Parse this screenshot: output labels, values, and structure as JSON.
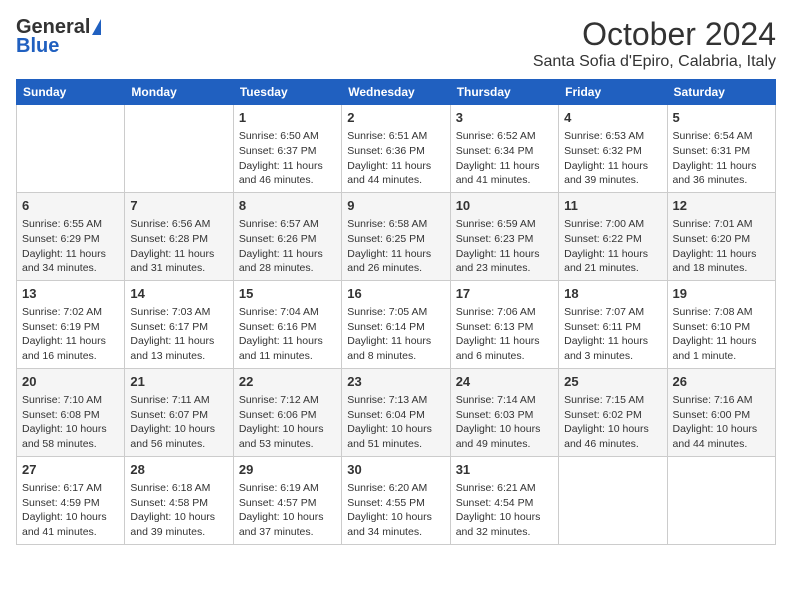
{
  "header": {
    "logo_general": "General",
    "logo_blue": "Blue",
    "month": "October 2024",
    "location": "Santa Sofia d'Epiro, Calabria, Italy"
  },
  "days_of_week": [
    "Sunday",
    "Monday",
    "Tuesday",
    "Wednesday",
    "Thursday",
    "Friday",
    "Saturday"
  ],
  "weeks": [
    [
      {
        "day": "",
        "info": ""
      },
      {
        "day": "",
        "info": ""
      },
      {
        "day": "1",
        "info": "Sunrise: 6:50 AM\nSunset: 6:37 PM\nDaylight: 11 hours and 46 minutes."
      },
      {
        "day": "2",
        "info": "Sunrise: 6:51 AM\nSunset: 6:36 PM\nDaylight: 11 hours and 44 minutes."
      },
      {
        "day": "3",
        "info": "Sunrise: 6:52 AM\nSunset: 6:34 PM\nDaylight: 11 hours and 41 minutes."
      },
      {
        "day": "4",
        "info": "Sunrise: 6:53 AM\nSunset: 6:32 PM\nDaylight: 11 hours and 39 minutes."
      },
      {
        "day": "5",
        "info": "Sunrise: 6:54 AM\nSunset: 6:31 PM\nDaylight: 11 hours and 36 minutes."
      }
    ],
    [
      {
        "day": "6",
        "info": "Sunrise: 6:55 AM\nSunset: 6:29 PM\nDaylight: 11 hours and 34 minutes."
      },
      {
        "day": "7",
        "info": "Sunrise: 6:56 AM\nSunset: 6:28 PM\nDaylight: 11 hours and 31 minutes."
      },
      {
        "day": "8",
        "info": "Sunrise: 6:57 AM\nSunset: 6:26 PM\nDaylight: 11 hours and 28 minutes."
      },
      {
        "day": "9",
        "info": "Sunrise: 6:58 AM\nSunset: 6:25 PM\nDaylight: 11 hours and 26 minutes."
      },
      {
        "day": "10",
        "info": "Sunrise: 6:59 AM\nSunset: 6:23 PM\nDaylight: 11 hours and 23 minutes."
      },
      {
        "day": "11",
        "info": "Sunrise: 7:00 AM\nSunset: 6:22 PM\nDaylight: 11 hours and 21 minutes."
      },
      {
        "day": "12",
        "info": "Sunrise: 7:01 AM\nSunset: 6:20 PM\nDaylight: 11 hours and 18 minutes."
      }
    ],
    [
      {
        "day": "13",
        "info": "Sunrise: 7:02 AM\nSunset: 6:19 PM\nDaylight: 11 hours and 16 minutes."
      },
      {
        "day": "14",
        "info": "Sunrise: 7:03 AM\nSunset: 6:17 PM\nDaylight: 11 hours and 13 minutes."
      },
      {
        "day": "15",
        "info": "Sunrise: 7:04 AM\nSunset: 6:16 PM\nDaylight: 11 hours and 11 minutes."
      },
      {
        "day": "16",
        "info": "Sunrise: 7:05 AM\nSunset: 6:14 PM\nDaylight: 11 hours and 8 minutes."
      },
      {
        "day": "17",
        "info": "Sunrise: 7:06 AM\nSunset: 6:13 PM\nDaylight: 11 hours and 6 minutes."
      },
      {
        "day": "18",
        "info": "Sunrise: 7:07 AM\nSunset: 6:11 PM\nDaylight: 11 hours and 3 minutes."
      },
      {
        "day": "19",
        "info": "Sunrise: 7:08 AM\nSunset: 6:10 PM\nDaylight: 11 hours and 1 minute."
      }
    ],
    [
      {
        "day": "20",
        "info": "Sunrise: 7:10 AM\nSunset: 6:08 PM\nDaylight: 10 hours and 58 minutes."
      },
      {
        "day": "21",
        "info": "Sunrise: 7:11 AM\nSunset: 6:07 PM\nDaylight: 10 hours and 56 minutes."
      },
      {
        "day": "22",
        "info": "Sunrise: 7:12 AM\nSunset: 6:06 PM\nDaylight: 10 hours and 53 minutes."
      },
      {
        "day": "23",
        "info": "Sunrise: 7:13 AM\nSunset: 6:04 PM\nDaylight: 10 hours and 51 minutes."
      },
      {
        "day": "24",
        "info": "Sunrise: 7:14 AM\nSunset: 6:03 PM\nDaylight: 10 hours and 49 minutes."
      },
      {
        "day": "25",
        "info": "Sunrise: 7:15 AM\nSunset: 6:02 PM\nDaylight: 10 hours and 46 minutes."
      },
      {
        "day": "26",
        "info": "Sunrise: 7:16 AM\nSunset: 6:00 PM\nDaylight: 10 hours and 44 minutes."
      }
    ],
    [
      {
        "day": "27",
        "info": "Sunrise: 6:17 AM\nSunset: 4:59 PM\nDaylight: 10 hours and 41 minutes."
      },
      {
        "day": "28",
        "info": "Sunrise: 6:18 AM\nSunset: 4:58 PM\nDaylight: 10 hours and 39 minutes."
      },
      {
        "day": "29",
        "info": "Sunrise: 6:19 AM\nSunset: 4:57 PM\nDaylight: 10 hours and 37 minutes."
      },
      {
        "day": "30",
        "info": "Sunrise: 6:20 AM\nSunset: 4:55 PM\nDaylight: 10 hours and 34 minutes."
      },
      {
        "day": "31",
        "info": "Sunrise: 6:21 AM\nSunset: 4:54 PM\nDaylight: 10 hours and 32 minutes."
      },
      {
        "day": "",
        "info": ""
      },
      {
        "day": "",
        "info": ""
      }
    ]
  ]
}
